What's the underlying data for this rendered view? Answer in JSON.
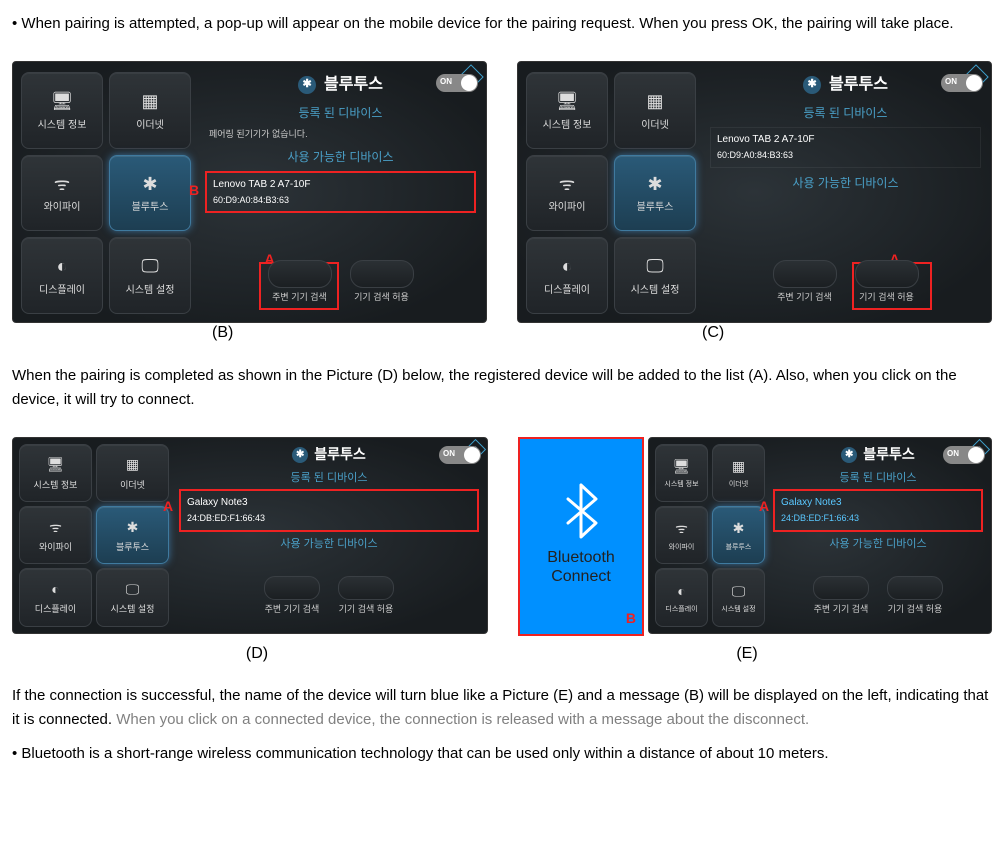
{
  "text": {
    "p1": "•  When pairing is attempted, a pop-up will appear on the mobile device for the pairing request. When you press OK, the pairing will take place.",
    "p2": "When the pairing is completed as shown in the Picture (D) below, the registered device will be added to the list (A). Also, when you click on the device, it will try to connect.",
    "p3a": "If the connection is successful, the name of the device will turn blue like a Picture (E) and a message (B) will be displayed on the left, indicating that it is connected. ",
    "p3b": "When you click on a connected device, the connection is released with a message about the disconnect.",
    "p4": "•  Bluetooth is a short-range wireless communication technology that can be used only within a distance of about 10 meters."
  },
  "captions": {
    "b": "(B)",
    "c": "(C)",
    "d": "(D)",
    "e": "(E)"
  },
  "tiles": {
    "sys": {
      "label": "시스템 정보",
      "icon": "🖥"
    },
    "eth": {
      "label": "이더넷",
      "icon": "▦"
    },
    "wifi": {
      "label": "와이파이",
      "icon": "ᯤ"
    },
    "bt": {
      "label": "블루투스",
      "icon": "✱"
    },
    "disp": {
      "label": "디스플레이",
      "icon": "◐"
    },
    "set": {
      "label": "시스템 설정",
      "icon": "🖵"
    }
  },
  "panel": {
    "title": "블루투스",
    "on": "ON",
    "sect_reg": "등록 된 디바이스",
    "sect_avail": "사용 가능한 디바이스",
    "no_pair": "페어링 된기기가 없습니다.",
    "btn1": "주변 기기 검색",
    "btn2": "기기 검색 허용"
  },
  "devices": {
    "lenovo": {
      "name": "Lenovo TAB 2 A7-10F",
      "addr": "60:D9:A0:84:B3:63"
    },
    "galaxy": {
      "name": "Galaxy Note3",
      "addr": "24:DB:ED:F1:66:43"
    }
  },
  "popup": {
    "line1": "Bluetooth",
    "line2": "Connect"
  },
  "marks": {
    "A": "A",
    "B": "B"
  }
}
